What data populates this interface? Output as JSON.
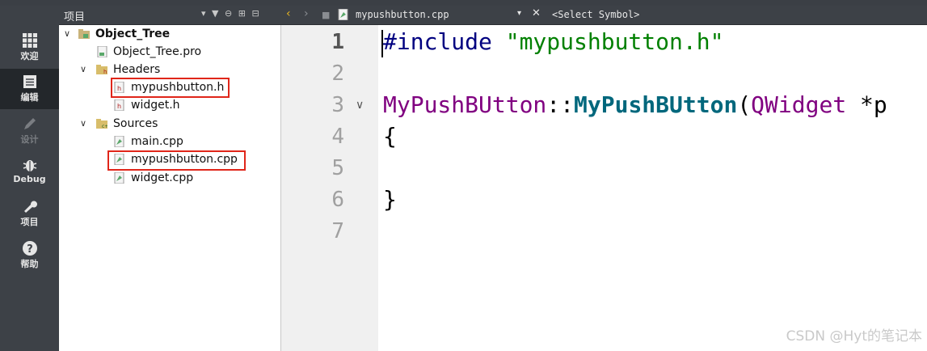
{
  "mode_bar": [
    {
      "label": "欢迎",
      "icon": "grid-icon",
      "active": false
    },
    {
      "label": "编辑",
      "icon": "document-icon",
      "active": true
    },
    {
      "label": "设计",
      "icon": "pencil-icon",
      "active": false
    },
    {
      "label": "Debug",
      "icon": "bug-icon",
      "active": false
    },
    {
      "label": "项目",
      "icon": "wrench-icon",
      "active": false
    },
    {
      "label": "帮助",
      "icon": "question-icon",
      "active": false
    }
  ],
  "project_panel": {
    "title": "项目",
    "tree": {
      "root": "Object_Tree",
      "pro_file": "Object_Tree.pro",
      "headers_label": "Headers",
      "headers": [
        "mypushbutton.h",
        "widget.h"
      ],
      "sources_label": "Sources",
      "sources": [
        "main.cpp",
        "mypushbutton.cpp",
        "widget.cpp"
      ]
    }
  },
  "editor": {
    "open_file": "mypushbutton.cpp",
    "symbol_placeholder": "<Select Symbol>",
    "line_numbers": [
      "1",
      "2",
      "3",
      "4",
      "5",
      "6",
      "7"
    ],
    "code": {
      "l1_directive": "#include",
      "l1_string": "\"mypushbutton.h\"",
      "l3_class": "MyPushBUtton",
      "l3_scope": "::",
      "l3_func": "MyPushBUtton",
      "l3_paren": "(",
      "l3_param_type": "QWidget",
      "l3_rest": " *p",
      "l4": "{",
      "l6": "}"
    }
  },
  "watermark": "CSDN @Hyt的笔记本",
  "colors": {
    "accent_highlight": "#e0261a",
    "sidebar_bg": "#3d4147"
  }
}
